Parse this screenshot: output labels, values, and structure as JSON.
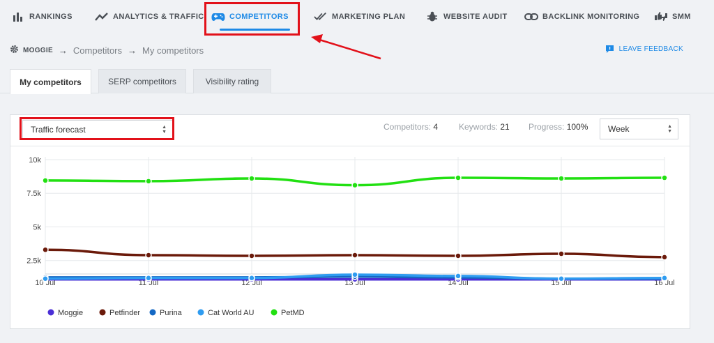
{
  "nav": {
    "items": [
      {
        "label": "RANKINGS",
        "icon": "bar-chart-icon"
      },
      {
        "label": "ANALYTICS & TRAFFIC",
        "icon": "trend-line-icon"
      },
      {
        "label": "COMPETITORS",
        "icon": "gamepad-icon",
        "active": true
      },
      {
        "label": "MARKETING PLAN",
        "icon": "double-check-icon"
      },
      {
        "label": "WEBSITE AUDIT",
        "icon": "bug-icon"
      },
      {
        "label": "BACKLINK MONITORING",
        "icon": "link-icon"
      },
      {
        "label": "SMM",
        "icon": "thumbs-icon"
      }
    ]
  },
  "breadcrumb": {
    "project": "MOGGIE",
    "level1": "Competitors",
    "level2": "My competitors",
    "separator": "→"
  },
  "feedback": {
    "label": "LEAVE FEEDBACK"
  },
  "tabs": [
    {
      "label": "My competitors",
      "active": true
    },
    {
      "label": "SERP competitors"
    },
    {
      "label": "Visibility rating"
    }
  ],
  "toolbar": {
    "metric_select": "Traffic forecast",
    "competitors_label": "Competitors:",
    "competitors_value": "4",
    "keywords_label": "Keywords:",
    "keywords_value": "21",
    "progress_label": "Progress:",
    "progress_value": "100%",
    "period_select": "Week"
  },
  "chart_data": {
    "type": "line",
    "x": [
      "10 Jul",
      "11 Jul",
      "12 Jul",
      "13 Jul",
      "14 Jul",
      "15 Jul",
      "16 Jul"
    ],
    "yticks": [
      "2.5k",
      "5k",
      "7.5k",
      "10k"
    ],
    "ylim": [
      1500,
      10000
    ],
    "grid": true,
    "legend": "bottom-left",
    "series": [
      {
        "name": "Moggie",
        "color": "#4b2fd6",
        "values": [
          1100,
          1100,
          1100,
          1100,
          1100,
          1100,
          1100
        ]
      },
      {
        "name": "Petfinder",
        "color": "#6b1a0a",
        "values": [
          3300,
          2900,
          2850,
          2900,
          2850,
          3000,
          2750
        ]
      },
      {
        "name": "Purina",
        "color": "#1468c4",
        "values": [
          1250,
          1250,
          1250,
          1300,
          1250,
          1150,
          1150
        ]
      },
      {
        "name": "Cat World AU",
        "color": "#2f9cf0",
        "values": [
          1150,
          1200,
          1200,
          1450,
          1350,
          1150,
          1200
        ]
      },
      {
        "name": "PetMD",
        "color": "#22e012",
        "values": [
          8450,
          8400,
          8600,
          8100,
          8650,
          8600,
          8650
        ]
      }
    ]
  }
}
